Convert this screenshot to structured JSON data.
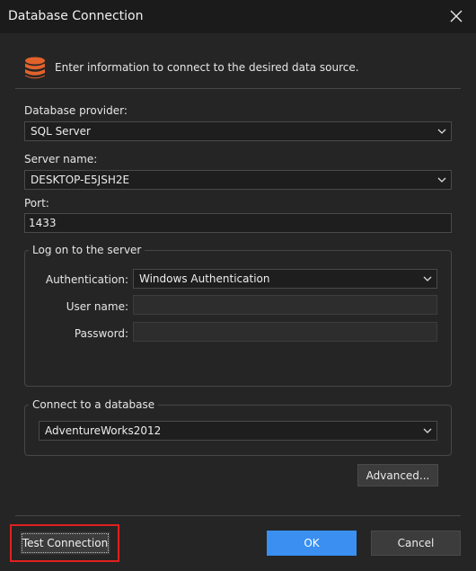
{
  "window": {
    "title": "Database Connection"
  },
  "intro": {
    "text": "Enter information to connect to the desired data source."
  },
  "provider": {
    "label": "Database provider:",
    "value": "SQL Server"
  },
  "server": {
    "label": "Server name:",
    "value": "DESKTOP-E5JSH2E"
  },
  "port": {
    "label": "Port:",
    "value": "1433"
  },
  "logon": {
    "legend": "Log on to the server",
    "auth_label": "Authentication:",
    "auth_value": "Windows Authentication",
    "username_label": "User name:",
    "username_value": "",
    "password_label": "Password:",
    "password_value": ""
  },
  "database": {
    "legend": "Connect to a database",
    "value": "AdventureWorks2012"
  },
  "buttons": {
    "advanced": "Advanced...",
    "test": "Test Connection",
    "ok": "OK",
    "cancel": "Cancel"
  },
  "colors": {
    "accent": "#3a8ff0",
    "highlight": "#e02020",
    "db_icon": "#e2622c"
  }
}
